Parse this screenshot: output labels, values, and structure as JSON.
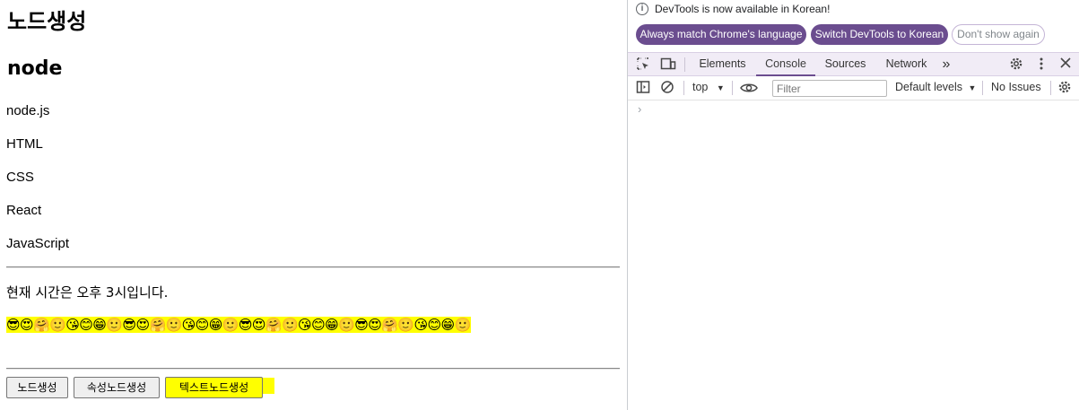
{
  "page": {
    "heading": "노드생성",
    "subheading": "node",
    "list": [
      "node.js",
      "HTML",
      "CSS",
      "React",
      "JavaScript"
    ],
    "time_text": "현재 시간은 오후 3시입니다.",
    "emoji_text": "😎😍🤗🙂😘😊😁🙂😎😍🤗🙂😘😊😁🙂😎😍🤗🙂😘😊😁🙂😎😍🤗🙂😘😊😁🙂",
    "buttons": {
      "create_node": "노드생성",
      "create_attr_node": "속성노드생성",
      "create_text_node": "텍스트노드생성"
    },
    "highlight_color": "#ffff00"
  },
  "devtools": {
    "info": {
      "icon": "info-icon",
      "message": "DevTools is now available in Korean!",
      "always_match": "Always match Chrome's language",
      "switch_korean": "Switch DevTools to Korean",
      "dont_show": "Don't show again"
    },
    "tabs": [
      "Elements",
      "Console",
      "Sources",
      "Network"
    ],
    "active_tab": "Console",
    "more_tabs": "»",
    "console": {
      "context": "top",
      "filter_placeholder": "Filter",
      "levels": "Default levels",
      "issues": "No Issues",
      "prompt": "›"
    },
    "accent_color": "#6b4d8f"
  }
}
